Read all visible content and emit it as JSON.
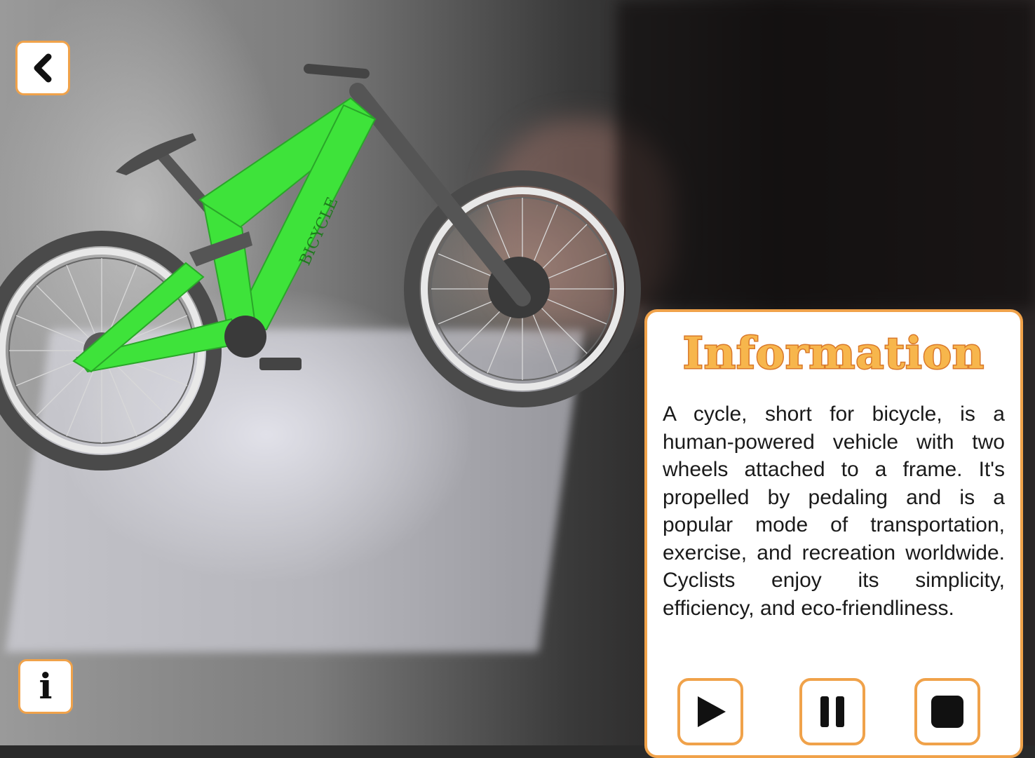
{
  "controls": {
    "back_icon": "chevron-left-icon",
    "info_icon": "info-icon",
    "info_glyph": "i"
  },
  "model": {
    "frame_label": "BICYCLE",
    "frame_color": "#3ee33a"
  },
  "info_panel": {
    "title": "Information",
    "body": "A cycle, short for bicycle, is a human-powered vehicle with two wheels attached to a frame. It's propelled by pedaling and is a popular mode of transportation, exercise, and recreation worldwide. Cyclists enjoy its simplicity, efficiency, and eco-friendliness.",
    "accent_color": "#f0a24a",
    "buttons": [
      {
        "name": "play",
        "icon": "play-icon"
      },
      {
        "name": "pause",
        "icon": "pause-icon"
      },
      {
        "name": "stop",
        "icon": "stop-icon"
      }
    ]
  }
}
